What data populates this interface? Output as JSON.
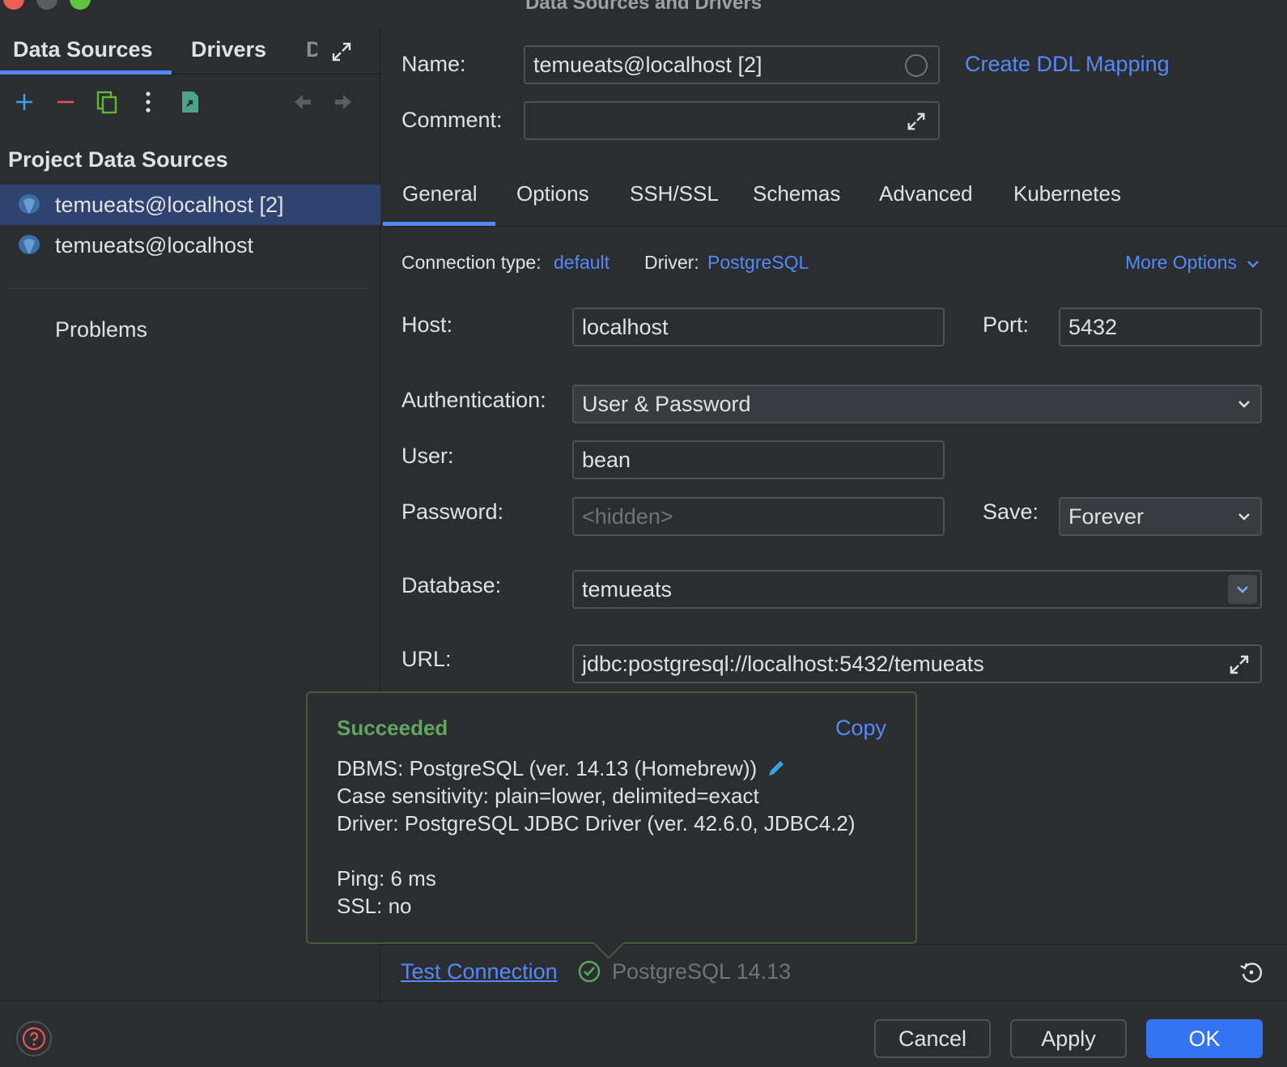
{
  "window": {
    "title": "Data Sources and Drivers"
  },
  "left": {
    "tabs": {
      "data_sources": "Data Sources",
      "drivers": "Drivers",
      "more": "D"
    },
    "section_title": "Project Data Sources",
    "items": [
      {
        "label": "temueats@localhost [2]"
      },
      {
        "label": "temueats@localhost"
      }
    ],
    "problems": "Problems"
  },
  "form": {
    "name_label": "Name:",
    "name_value": "temueats@localhost [2]",
    "create_ddl": "Create DDL Mapping",
    "comment_label": "Comment:",
    "comment_value": "",
    "tabs": [
      "General",
      "Options",
      "SSH/SSL",
      "Schemas",
      "Advanced",
      "Kubernetes"
    ],
    "conn_type_label": "Connection type:",
    "conn_type_value": "default",
    "driver_label": "Driver:",
    "driver_value": "PostgreSQL",
    "more_options": "More Options",
    "host_label": "Host:",
    "host_value": "localhost",
    "port_label": "Port:",
    "port_value": "5432",
    "auth_label": "Authentication:",
    "auth_value": "User & Password",
    "user_label": "User:",
    "user_value": "bean",
    "password_label": "Password:",
    "password_placeholder": "<hidden>",
    "save_label": "Save:",
    "save_value": "Forever",
    "database_label": "Database:",
    "database_value": "temueats",
    "url_label": "URL:",
    "url_value": "jdbc:postgresql://localhost:5432/temueats"
  },
  "popup": {
    "title": "Succeeded",
    "copy": "Copy",
    "dbms": "DBMS: PostgreSQL (ver. 14.13 (Homebrew))",
    "case": "Case sensitivity: plain=lower, delimited=exact",
    "driver": "Driver: PostgreSQL JDBC Driver (ver. 42.6.0, JDBC4.2)",
    "ping": "Ping: 6 ms",
    "ssl": "SSL: no"
  },
  "connection": {
    "test_link": "Test Connection",
    "status": "PostgreSQL 14.13"
  },
  "footer": {
    "cancel": "Cancel",
    "apply": "Apply",
    "ok": "OK"
  },
  "colors": {
    "accent": "#548af7",
    "success": "#5fa760",
    "selection": "#2e436e",
    "primary_button": "#3574f0"
  }
}
